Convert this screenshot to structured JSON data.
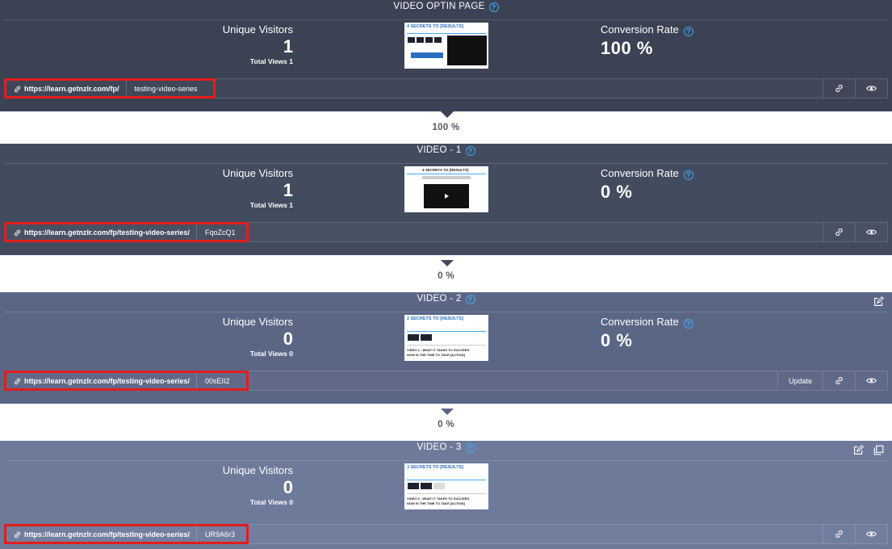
{
  "steps": [
    {
      "title": "VIDEO OPTIN PAGE",
      "unique_label": "Unique Visitors",
      "unique_value": "1",
      "total_views": "Total Views 1",
      "conversion_label": "Conversion Rate",
      "conversion_value": "100 %",
      "url_prefix": "https://learn.getnzlr.com/fp/",
      "url_slug": "testing-video-series",
      "thumb_heading": "4 SECRETS TO [RESULTS]"
    },
    {
      "title": "VIDEO - 1",
      "unique_label": "Unique Visitors",
      "unique_value": "1",
      "total_views": "Total Views 1",
      "conversion_label": "Conversion Rate",
      "conversion_value": "0 %",
      "url_prefix": "https://learn.getnzlr.com/fp/testing-video-series/",
      "url_slug": "FqoZcQ1",
      "thumb_heading": "4 SECRETS TO [RESULTS]"
    },
    {
      "title": "VIDEO - 2",
      "unique_label": "Unique Visitors",
      "unique_value": "0",
      "total_views": "Total Views 0",
      "conversion_label": "Conversion Rate",
      "conversion_value": "0 %",
      "url_prefix": "https://learn.getnzlr.com/fp/testing-video-series/",
      "url_slug": "00sEII2",
      "update_label": "Update",
      "thumb_heading": "2 SECRETS TO [RESULTS]",
      "thumb_line": "VIDEO 2 - WHAT IT TAKES TO SUCCEED",
      "thumb_line2": "NOW IS THE TIME TO TAKE [ACTION]"
    },
    {
      "title": "VIDEO - 3",
      "unique_label": "Unique Visitors",
      "unique_value": "0",
      "total_views": "Total Views 0",
      "url_prefix": "https://learn.getnzlr.com/fp/testing-video-series/",
      "url_slug": "UR9A6r3",
      "thumb_heading": "3 SECRETS TO [RESULTS]",
      "thumb_line": "VIDEO 3 - WHAT IT TAKES TO SUCCEED",
      "thumb_line2": "NOW IS THE TIME TO TAKE [ACTION]"
    }
  ],
  "connectors": [
    "100 %",
    "0 %",
    "0 %"
  ],
  "colors": {
    "highlight": "#e41c1c",
    "help_icon": "#3fa9f5"
  }
}
